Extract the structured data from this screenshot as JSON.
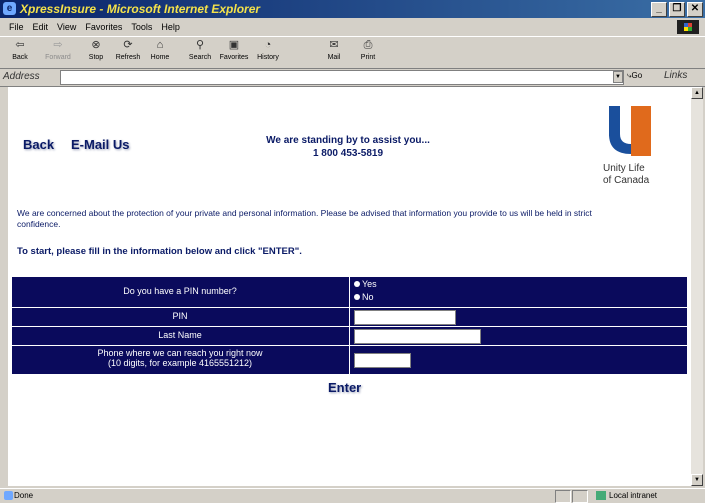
{
  "window": {
    "title": "XpressInsure - Microsoft Internet Explorer",
    "buttons": [
      "_",
      "❐",
      "✕"
    ]
  },
  "menu": [
    "File",
    "Edit",
    "View",
    "Favorites",
    "Tools",
    "Help"
  ],
  "toolbar": {
    "back": "Back",
    "forward": "Forward",
    "stop": "Stop",
    "refresh": "Refresh",
    "home": "Home",
    "search": "Search",
    "favorites": "Favorites",
    "history": "History",
    "mail": "Mail",
    "print": "Print"
  },
  "address": {
    "label": "Address",
    "value": "",
    "go": "Go",
    "links": "Links"
  },
  "page": {
    "back_link": "Back",
    "email_link": "E-Mail Us",
    "standby_line1": "We are standing by to assist you...",
    "standby_line2": "1 800 453-5819",
    "logo_line1": "Unity Life",
    "logo_line2": "of Canada",
    "privacy": "We are concerned about the protection of your private and personal information. Please be advised that information you provide to us will be held in strict confidence.",
    "instruction": "To start, please fill in the information below and click \"ENTER\".",
    "form": {
      "pin_question": "Do you have a PIN number?",
      "yes": "Yes",
      "no": "No",
      "pin_label": "PIN",
      "last_name_label": "Last Name",
      "phone_line1": "Phone where we can reach you right now",
      "phone_line2": "(10 digits, for example 4165551212)",
      "enter": "Enter"
    }
  },
  "status": {
    "text": "Done",
    "zone": "Local intranet"
  },
  "colors": {
    "form_bg": "#0a0a5c",
    "text_navy": "#0a1a66",
    "logo_blue": "#1a4f9c",
    "logo_orange": "#e06a1c"
  }
}
